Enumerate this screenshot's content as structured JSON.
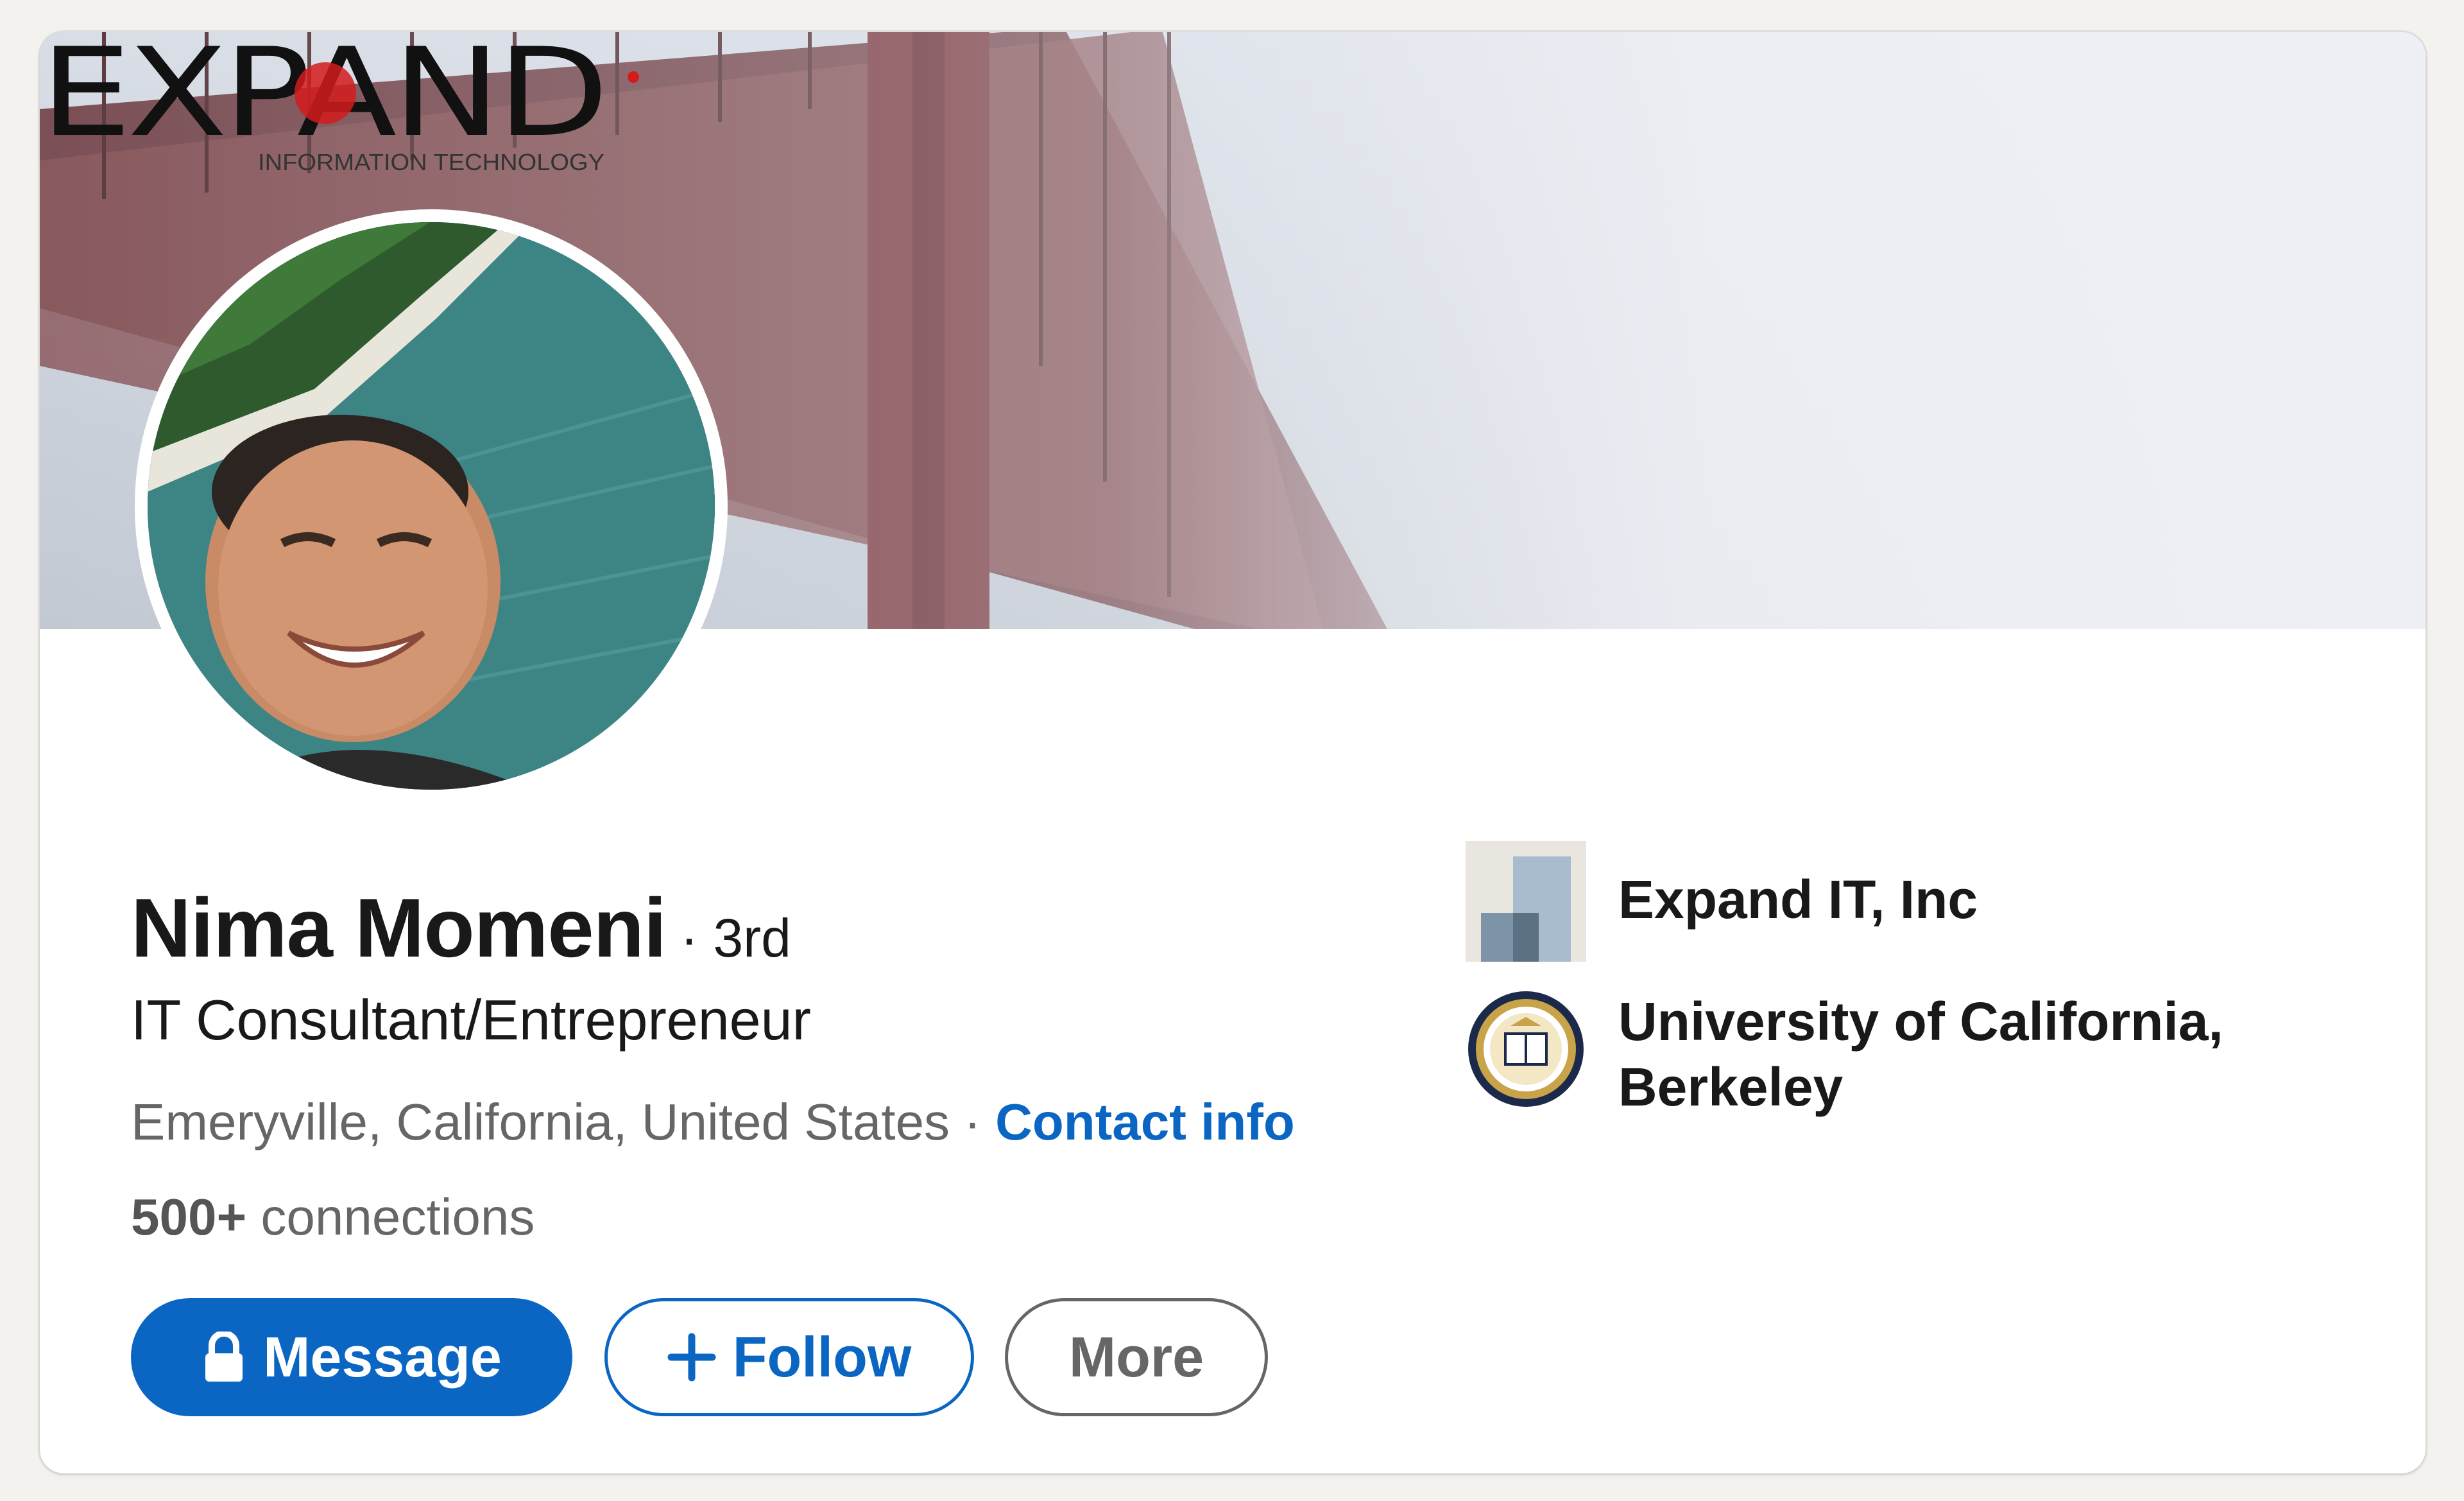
{
  "profile": {
    "name": "Nima Momeni",
    "degree": "· 3rd",
    "headline": "IT Consultant/Entrepreneur",
    "location": "Emeryville, California, United States",
    "separator": " · ",
    "contact_link": "Contact info",
    "connections_count": "500+",
    "connections_label": " connections"
  },
  "banner": {
    "logo_text": "EXPAND",
    "logo_subtext": "INFORMATION TECHNOLOGY"
  },
  "actions": {
    "message": "Message",
    "follow": "Follow",
    "more": "More"
  },
  "icons": {
    "message": "lock-icon",
    "follow": "plus-icon"
  },
  "organizations": [
    {
      "name": "Expand IT, Inc",
      "logo": "company-logo-icon"
    },
    {
      "name": "University of California, Berkeley",
      "logo": "uc-berkeley-seal-icon"
    }
  ],
  "colors": {
    "primary": "#0a66c2",
    "text": "#191919",
    "muted": "#666666",
    "background": "#f3f2ef"
  }
}
